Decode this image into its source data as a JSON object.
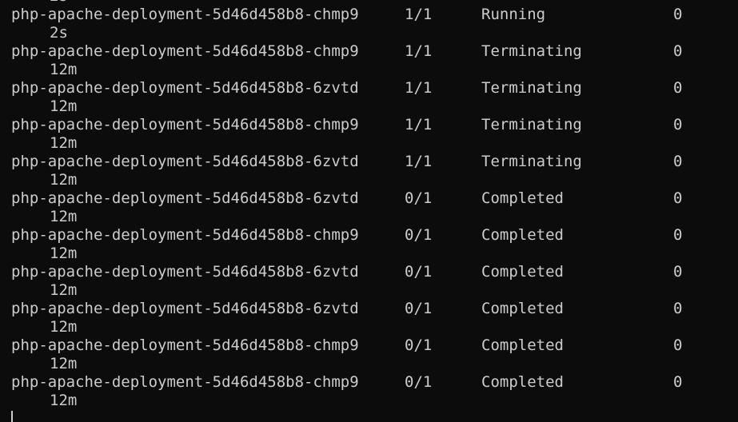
{
  "terminal": {
    "partial_top": "2s",
    "rows": [
      {
        "name": "php-apache-deployment-5d46d458b8-chmp9",
        "ready": "1/1",
        "status": "Running",
        "restarts": "0",
        "age": "2s"
      },
      {
        "name": "php-apache-deployment-5d46d458b8-chmp9",
        "ready": "1/1",
        "status": "Terminating",
        "restarts": "0",
        "age": "12m"
      },
      {
        "name": "php-apache-deployment-5d46d458b8-6zvtd",
        "ready": "1/1",
        "status": "Terminating",
        "restarts": "0",
        "age": "12m"
      },
      {
        "name": "php-apache-deployment-5d46d458b8-chmp9",
        "ready": "1/1",
        "status": "Terminating",
        "restarts": "0",
        "age": "12m"
      },
      {
        "name": "php-apache-deployment-5d46d458b8-6zvtd",
        "ready": "1/1",
        "status": "Terminating",
        "restarts": "0",
        "age": "12m"
      },
      {
        "name": "php-apache-deployment-5d46d458b8-6zvtd",
        "ready": "0/1",
        "status": "Completed",
        "restarts": "0",
        "age": "12m"
      },
      {
        "name": "php-apache-deployment-5d46d458b8-chmp9",
        "ready": "0/1",
        "status": "Completed",
        "restarts": "0",
        "age": "12m"
      },
      {
        "name": "php-apache-deployment-5d46d458b8-6zvtd",
        "ready": "0/1",
        "status": "Completed",
        "restarts": "0",
        "age": "12m"
      },
      {
        "name": "php-apache-deployment-5d46d458b8-6zvtd",
        "ready": "0/1",
        "status": "Completed",
        "restarts": "0",
        "age": "12m"
      },
      {
        "name": "php-apache-deployment-5d46d458b8-chmp9",
        "ready": "0/1",
        "status": "Completed",
        "restarts": "0",
        "age": "12m"
      },
      {
        "name": "php-apache-deployment-5d46d458b8-chmp9",
        "ready": "0/1",
        "status": "Completed",
        "restarts": "0",
        "age": "12m"
      }
    ]
  },
  "colors": {
    "background": "#0c0c0c",
    "foreground": "#cccccc"
  }
}
